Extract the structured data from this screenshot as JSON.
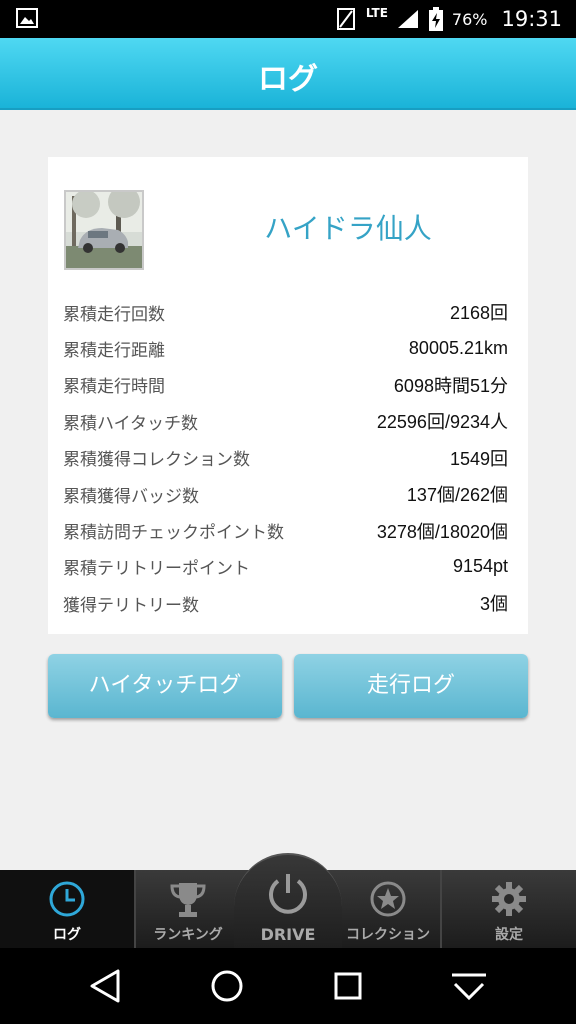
{
  "status_bar": {
    "network": "LTE",
    "battery": "76%",
    "time": "19:31"
  },
  "header": {
    "title": "ログ"
  },
  "profile": {
    "name": "ハイドラ仙人"
  },
  "stats": [
    {
      "label": "累積走行回数",
      "value": "2168回"
    },
    {
      "label": "累積走行距離",
      "value": "80005.21km"
    },
    {
      "label": "累積走行時間",
      "value": "6098時間51分"
    },
    {
      "label": "累積ハイタッチ数",
      "value": "22596回/9234人"
    },
    {
      "label": "累積獲得コレクション数",
      "value": "1549回"
    },
    {
      "label": "累積獲得バッジ数",
      "value": "137個/262個"
    },
    {
      "label": "累積訪問チェックポイント数",
      "value": "3278個/18020個"
    },
    {
      "label": "累積テリトリーポイント",
      "value": "9154pt"
    },
    {
      "label": "獲得テリトリー数",
      "value": "3個"
    }
  ],
  "buttons": {
    "hitouch_log": "ハイタッチログ",
    "drive_log": "走行ログ"
  },
  "tabs": {
    "log": "ログ",
    "ranking": "ランキング",
    "drive": "DRIVE",
    "collection": "コレクション",
    "settings": "設定"
  },
  "icons": {
    "status_left": "image-notification-icon",
    "log": "clock-icon",
    "ranking": "trophy-icon",
    "drive": "power-icon",
    "collection": "star-circle-icon",
    "settings": "gear-icon",
    "nav_back": "back-triangle-icon",
    "nav_home": "home-circle-icon",
    "nav_recent": "recent-square-icon",
    "nav_dropdown": "dropdown-icon"
  },
  "colors": {
    "header_top": "#4fd8f2",
    "header_bottom": "#1ab3d8",
    "accent_name": "#35a3c6",
    "button_top": "#8fd2e4",
    "button_bottom": "#5ab6d0",
    "active_tab_icon": "#2fa8d9"
  }
}
